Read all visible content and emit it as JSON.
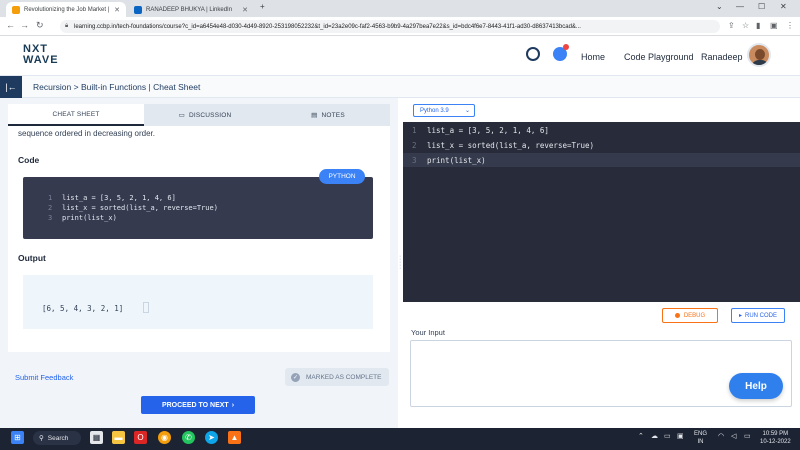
{
  "browser": {
    "tabs": [
      {
        "label": "Revolutionizing the Job Market |",
        "active": true
      },
      {
        "label": "RANADEEP BHUKYA | LinkedIn",
        "active": false
      }
    ],
    "new_tab": "+",
    "url": "learning.ccbp.in/tech-foundations/course?c_id=a6454e48-d030-4d49-8920-253198052232&t_id=23a2e09c-faf2-4563-b9b9-4a297bea7e22&s_id=bdc4f6e7-8443-41f1-ad30-d8637413bcad&..."
  },
  "site": {
    "logo_line1": "NXT",
    "logo_line2": "WAVE",
    "nav": {
      "home": "Home",
      "playground": "Code Playground",
      "user": "Ranadeep"
    }
  },
  "breadcrumb": "Recursion > Built-in Functions | Cheat Sheet",
  "left": {
    "tabs": [
      "CHEAT SHEET",
      "DISCUSSION",
      "NOTES"
    ],
    "description": "sequence ordered in decreasing order.",
    "code_heading": "Code",
    "lang_pill": "PYTHON",
    "code_lines": [
      "list_a = [3, 5, 2, 1, 4, 6]",
      "list_x = sorted(list_a, reverse=True)",
      "print(list_x)"
    ],
    "output_heading": "Output",
    "output": "[6, 5, 4, 3, 2, 1]",
    "submit_feedback": "Submit Feedback",
    "marked_complete": "MARKED AS COMPLETE",
    "proceed": "PROCEED TO NEXT"
  },
  "right": {
    "language": "Python 3.9",
    "editor_lines": [
      "list_a = [3, 5, 2, 1, 4, 6]",
      "list_x = sorted(list_a, reverse=True)",
      "print(list_x)"
    ],
    "debug": "DEBUG",
    "run": "RUN CODE",
    "input_label": "Your Input",
    "help": "Help"
  },
  "taskbar": {
    "search": "Search",
    "lang_line1": "ENG",
    "lang_line2": "IN",
    "time": "10:59 PM",
    "date": "10-12-2022"
  }
}
